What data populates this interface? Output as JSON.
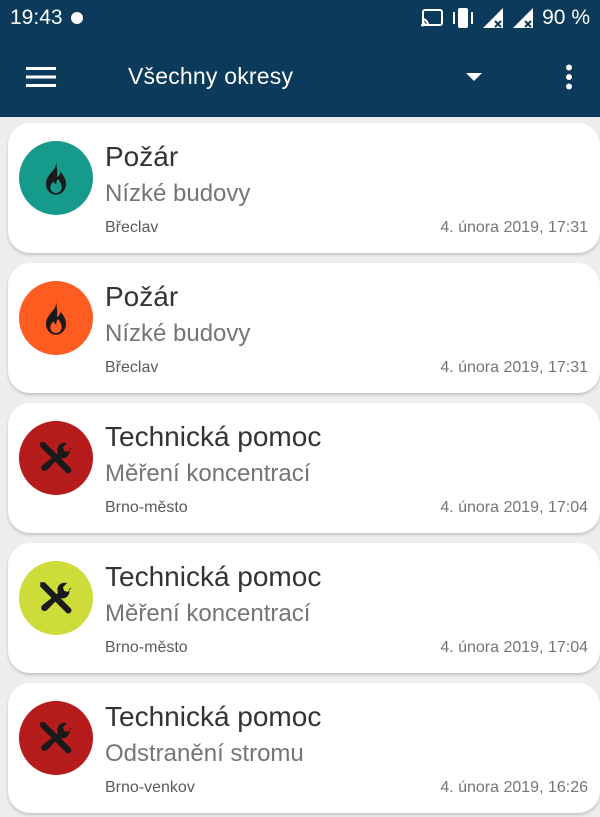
{
  "status_bar": {
    "time": "19:43",
    "battery": "90 %",
    "icons": [
      "notification-dot-icon",
      "cast-icon",
      "vibrate-icon",
      "signal-icon",
      "signal-icon",
      "battery-text"
    ]
  },
  "toolbar": {
    "title": "Všechny okresy",
    "menu_icon": "hamburger-menu-icon",
    "dropdown_icon": "dropdown-arrow-icon",
    "more_icon": "more-vert-icon",
    "background": "#0b3a5b"
  },
  "incidents": [
    {
      "type": "Požár",
      "subtype": "Nízké budovy",
      "district": "Břeclav",
      "datetime": "4. února 2019, 17:31",
      "icon": "fire-icon",
      "color": "#169a8c"
    },
    {
      "type": "Požár",
      "subtype": "Nízké budovy",
      "district": "Břeclav",
      "datetime": "4. února 2019, 17:31",
      "icon": "fire-icon",
      "color": "#ff5c22"
    },
    {
      "type": "Technická pomoc",
      "subtype": "Měření koncentrací",
      "district": "Brno-město",
      "datetime": "4. února 2019, 17:04",
      "icon": "tools-icon",
      "color": "#b71c1c"
    },
    {
      "type": "Technická pomoc",
      "subtype": "Měření koncentrací",
      "district": "Brno-město",
      "datetime": "4. února 2019, 17:04",
      "icon": "tools-icon",
      "color": "#cddc39"
    },
    {
      "type": "Technická pomoc",
      "subtype": "Odstranění stromu",
      "district": "Brno-venkov",
      "datetime": "4. února 2019, 16:26",
      "icon": "tools-icon",
      "color": "#b71c1c"
    }
  ]
}
